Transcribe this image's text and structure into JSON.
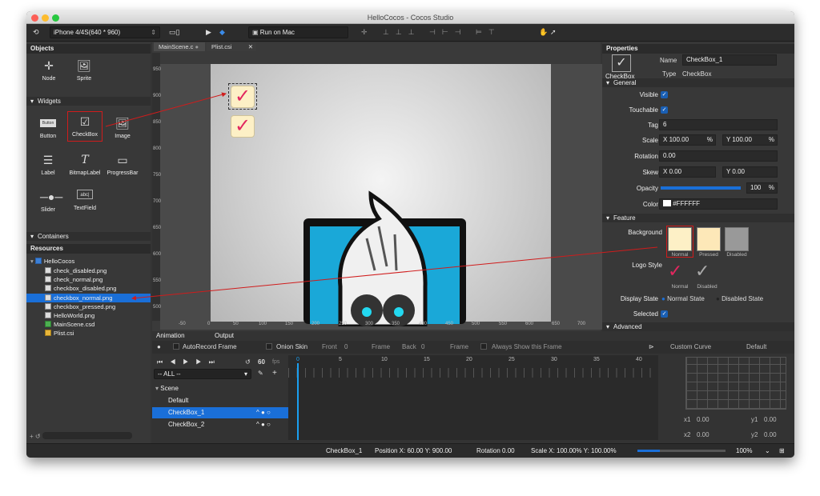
{
  "window": {
    "title": "HelloCocos - Cocos Studio"
  },
  "toolbar": {
    "device": "iPhone 4/4S(640 * 960)",
    "run": "Run on Mac"
  },
  "objects": {
    "title": "Objects",
    "items": [
      "Node",
      "Sprite"
    ]
  },
  "widgets": {
    "title": "Widgets",
    "items": [
      "Button",
      "CheckBox",
      "Image",
      "Label",
      "BitmapLabel",
      "ProgressBar",
      "Slider",
      "TextField"
    ],
    "button_icon_text": "Button",
    "textfield_icon_text": "abc|"
  },
  "containers": {
    "title": "Containers"
  },
  "resources": {
    "title": "Resources",
    "root": "HelloCocos",
    "files": [
      "check_disabled.png",
      "check_normal.png",
      "checkbox_disabled.png",
      "checkbox_normal.png",
      "checkbox_pressed.png",
      "HelloWorld.png",
      "MainScene.csd",
      "Plist.csi"
    ]
  },
  "tabs": [
    "MainScene.c",
    "Plist.csi"
  ],
  "ruler": {
    "top": [
      "-50",
      "0",
      "50",
      "100",
      "150",
      "200",
      "250",
      "300",
      "350",
      "400",
      "450",
      "500",
      "550",
      "600",
      "650",
      "700"
    ],
    "left": [
      "950",
      "900",
      "850",
      "800",
      "750",
      "700",
      "650",
      "600",
      "550",
      "500",
      "450",
      "400"
    ]
  },
  "properties": {
    "title": "Properties",
    "type_icon_label": "CheckBox",
    "name_label": "Name",
    "name": "CheckBox_1",
    "type_label": "Type",
    "type": "CheckBox",
    "general": "General",
    "visible": "Visible",
    "touchable": "Touchable",
    "tag_label": "Tag",
    "tag": "6",
    "scale_label": "Scale",
    "scale_x": "100.00",
    "scale_y": "100.00",
    "rotation_label": "Rotation",
    "rotation": "0.00",
    "skew_label": "Skew",
    "skew_x": "0.00",
    "skew_y": "0.00",
    "opacity_label": "Opacity",
    "opacity": "100",
    "opacity_value": 1.0,
    "color_label": "Color",
    "color": "#FFFFFF",
    "feature": "Feature",
    "background": "Background",
    "bg_states": [
      "Normal",
      "Pressed",
      "Disabled"
    ],
    "logo_style": "Logo Style",
    "logo_states": [
      "Normal",
      "Disabled"
    ],
    "display_state": "Display State",
    "display_options": [
      "Normal State",
      "Disabled State"
    ],
    "selected": "Selected",
    "advanced": "Advanced"
  },
  "animation": {
    "tabs": [
      "Animation",
      "Output"
    ],
    "autorecord": "AutoRecord Frame",
    "onion": "Onion Skin",
    "front": "Front",
    "front_val": "0",
    "frame": "Frame",
    "back": "Back",
    "back_val": "0",
    "always": "Always Show this Frame",
    "fps": "60",
    "fps_label": "fps",
    "filter": "-- ALL --",
    "tree": [
      "Scene",
      "Default",
      "CheckBox_1",
      "CheckBox_2"
    ],
    "ticks": [
      "0",
      "5",
      "10",
      "15",
      "20",
      "25",
      "30",
      "35",
      "40"
    ],
    "curve": "Custom Curve",
    "curve_default": "Default",
    "x1": "x1",
    "x1v": "0.00",
    "y1": "y1",
    "y1v": "0.00",
    "x2": "x2",
    "x2v": "0.00",
    "y2": "y2",
    "y2v": "0.00"
  },
  "status": {
    "name": "CheckBox_1",
    "position": "Position X: 60.00  Y: 900.00",
    "rotation": "Rotation 0.00",
    "scale": "Scale X: 100.00%  Y: 100.00%",
    "zoom": "100%"
  },
  "colors": {
    "accent": "#1a6fd8",
    "highlight": "#cc1b1b",
    "check": "#e2275f"
  }
}
